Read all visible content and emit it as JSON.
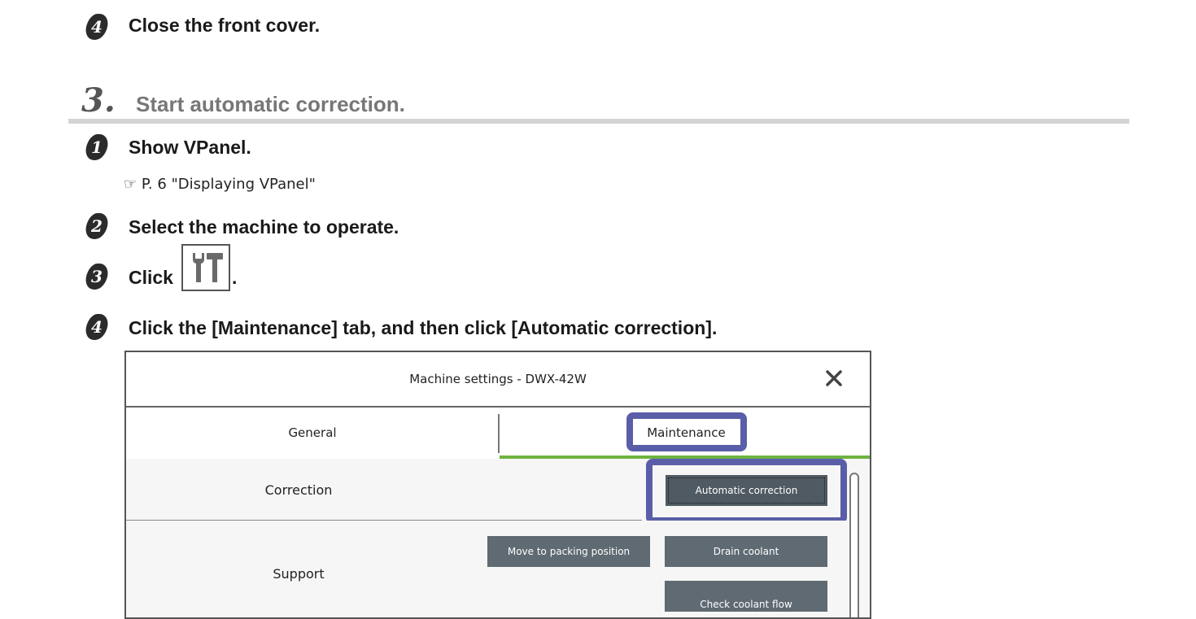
{
  "steps_top": [
    {
      "num": "4",
      "text": "Close the front cover."
    }
  ],
  "section": {
    "number": "3.",
    "title": "Start automatic correction."
  },
  "steps": [
    {
      "num": "1",
      "text": "Show VPanel."
    },
    {
      "num": "2",
      "text": "Select the machine to operate."
    },
    {
      "num": "3",
      "text_before": "Click",
      "text_after": "."
    },
    {
      "num": "4",
      "text": "Click the [Maintenance] tab, and then click [Automatic correction]."
    }
  ],
  "reference": "☞ P. 6 \"Displaying VPanel\"",
  "icons": {
    "tool": "settings-tools-icon",
    "close": "close-icon"
  },
  "colors": {
    "highlight": "#5a5ea8",
    "tab_accent": "#6db33f",
    "button": "#5f6a72"
  },
  "dialog": {
    "title": "Machine settings - DWX-42W",
    "tabs": {
      "general": "General",
      "maintenance": "Maintenance"
    },
    "rows": {
      "correction": {
        "label": "Correction",
        "buttons": [
          "Automatic correction"
        ]
      },
      "support": {
        "label": "Support",
        "buttons": [
          "Move to packing position",
          "Drain coolant",
          "Check coolant flow"
        ]
      }
    }
  }
}
